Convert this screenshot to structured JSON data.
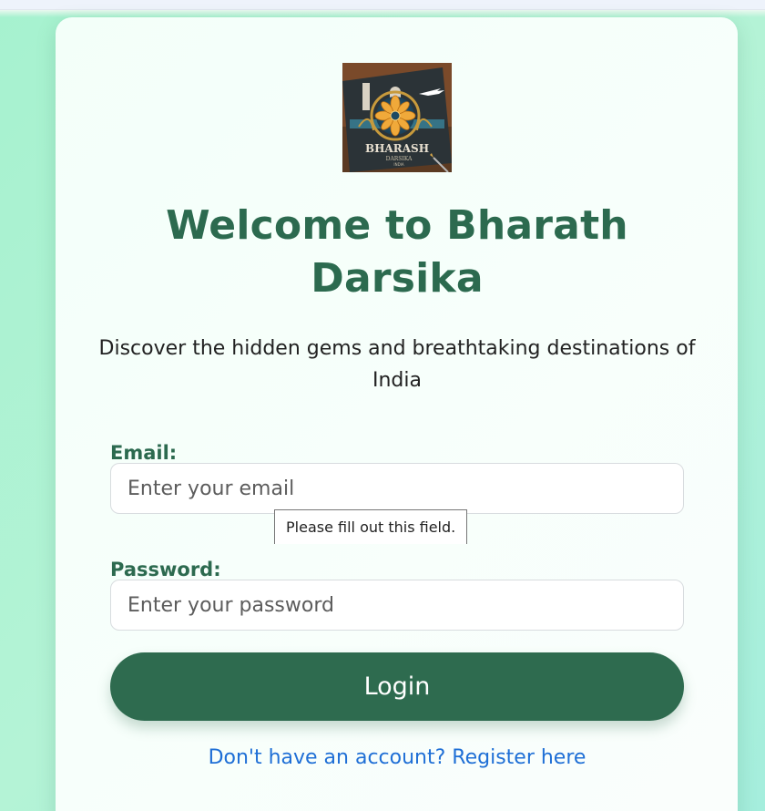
{
  "logo": {
    "text": "BHARASH",
    "subtext": "DARSIKA",
    "country": "INDIA"
  },
  "page": {
    "title": "Welcome to Bharath Darsika",
    "subtitle": "Discover the hidden gems and breathtaking destinations of India"
  },
  "form": {
    "email_label": "Email:",
    "email_placeholder": "Enter your email",
    "email_value": "",
    "password_label": "Password:",
    "password_placeholder": "Enter your password",
    "password_value": "",
    "validation_tooltip": "Please fill out this field.",
    "login_label": "Login",
    "register_link": "Don't have an account? Register here"
  },
  "colors": {
    "brand": "#2e6b4f",
    "link": "#1f6fd6",
    "background": "#a6f2cf"
  }
}
